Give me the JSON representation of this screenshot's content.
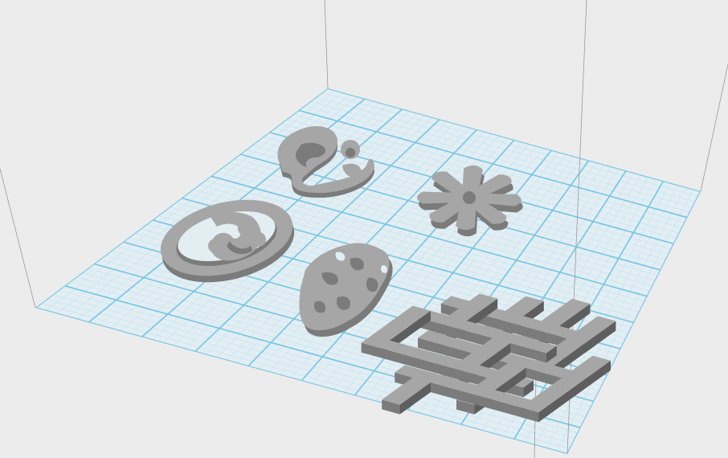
{
  "viewport": {
    "background": "#ececec",
    "view": "perspective",
    "show_build_volume": true,
    "show_grid": true
  },
  "build_plate": {
    "grid_minor_color": "#bfe3f1",
    "grid_major_color": "#74c5e6",
    "grid_major_divisions": 10,
    "grid_minor_per_major": 5,
    "plate_tint": "#e3eef3"
  },
  "volume_edges": {
    "color": "#9a9a9a"
  },
  "models": {
    "color_top": "#a6a6a6",
    "color_side": "#7b7b7b",
    "color_dark": "#5e5e5e",
    "items": [
      {
        "name": "swirl-symbol"
      },
      {
        "name": "star-flower-symbol"
      },
      {
        "name": "oval-ring-symbol"
      },
      {
        "name": "leaf-symbol"
      },
      {
        "name": "knot-grid-symbol"
      }
    ]
  }
}
